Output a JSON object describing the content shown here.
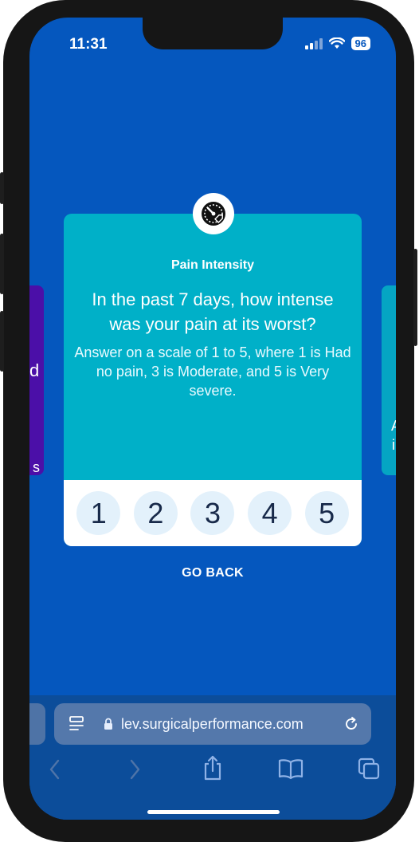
{
  "status": {
    "time": "11:31",
    "battery": "96"
  },
  "card": {
    "title": "Pain Intensity",
    "question": "In the past 7 days, how intense was your pain at its worst?",
    "hint": "Answer on a scale of 1 to 5, where 1 is Had no pain, 3 is Moderate, and 5 is Very severe.",
    "scale": [
      "1",
      "2",
      "3",
      "4",
      "5"
    ]
  },
  "side_left": {
    "frag1": "d",
    "frag2": "s"
  },
  "side_right": {
    "frag1": "A",
    "frag2": "i"
  },
  "go_back": "GO BACK",
  "browser": {
    "url": "lev.surgicalperformance.com"
  },
  "icons": {
    "card": "gauge-icon",
    "tabs": "page-menu-icon",
    "lock": "lock-icon",
    "reload": "reload-icon",
    "back": "chevron-left-icon",
    "forward": "chevron-right-icon",
    "share": "share-icon",
    "bookmarks": "book-icon",
    "tabs_overview": "tabs-icon"
  },
  "colors": {
    "background": "#0557be",
    "card": "#00b0c8",
    "scale_button": "#e3f1fb"
  }
}
